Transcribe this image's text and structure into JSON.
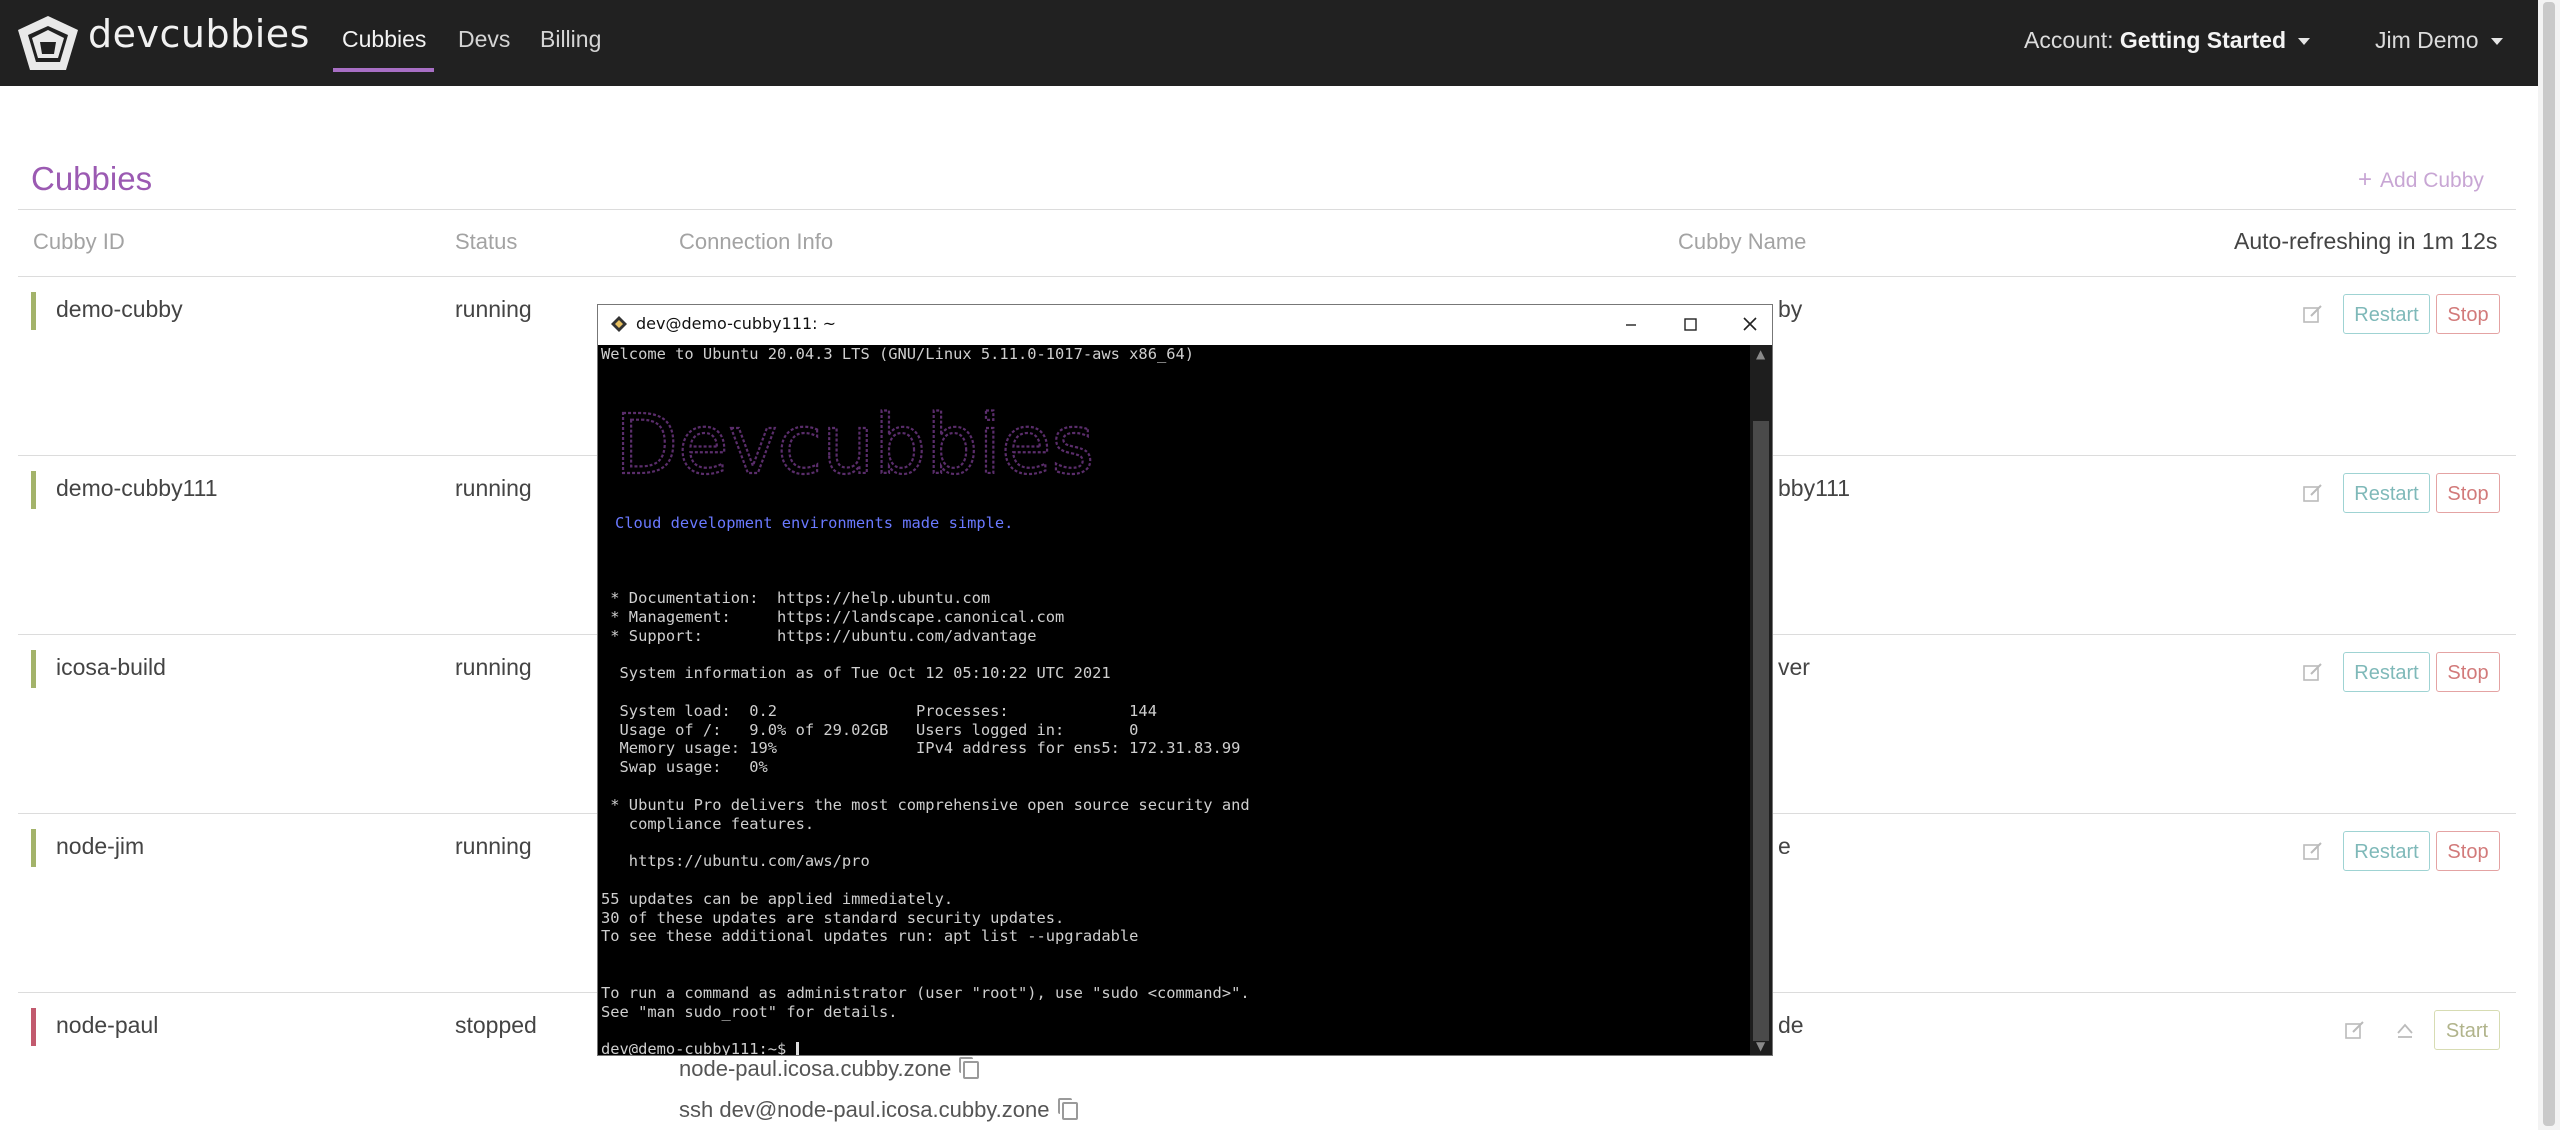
{
  "navbar": {
    "brand": "devcubbies",
    "links": [
      "Cubbies",
      "Devs",
      "Billing"
    ],
    "account_label": "Account:",
    "account_name": "Getting Started",
    "user": "Jim Demo"
  },
  "page": {
    "title": "Cubbies",
    "add_label": "Add Cubby",
    "columns": [
      "Cubby ID",
      "Status",
      "Connection Info",
      "Cubby Name"
    ],
    "auto_refresh": "Auto-refreshing in 1m 12s"
  },
  "rows": [
    {
      "id": "demo-cubby",
      "status": "running",
      "name_visible": "by",
      "color": "#a3b36a"
    },
    {
      "id": "demo-cubby111",
      "status": "running",
      "name_visible": "bby111",
      "color": "#a3b36a"
    },
    {
      "id": "icosa-build",
      "status": "running",
      "name_visible": "ver",
      "color": "#a3b36a"
    },
    {
      "id": "node-jim",
      "status": "running",
      "name_visible": "e",
      "color": "#a3b36a"
    },
    {
      "id": "node-paul",
      "status": "stopped",
      "name_visible": "de",
      "color": "#c25a6e",
      "conn": [
        "node-paul.icosa.cubby.zone",
        "ssh dev@node-paul.icosa.cubby.zone"
      ]
    }
  ],
  "buttons": {
    "restart": "Restart",
    "stop": "Stop",
    "start": "Start"
  },
  "terminal": {
    "title": "dev@demo-cubby111: ~",
    "welcome": "Welcome to Ubuntu 20.04.3 LTS (GNU/Linux 5.11.0-1017-aws x86_64)",
    "ascii_art": "Devcubbies",
    "tagline": "Cloud development environments made simple.",
    "docs": [
      " * Documentation:  https://help.ubuntu.com",
      " * Management:     https://landscape.canonical.com",
      " * Support:        https://ubuntu.com/advantage"
    ],
    "sysinfo_header": "  System information as of Tue Oct 12 05:10:22 UTC 2021",
    "sysinfo": [
      "  System load:  0.2               Processes:             144",
      "  Usage of /:   9.0% of 29.02GB   Users logged in:       0",
      "  Memory usage: 19%               IPv4 address for ens5: 172.31.83.99",
      "  Swap usage:   0%"
    ],
    "pro": [
      " * Ubuntu Pro delivers the most comprehensive open source security and",
      "   compliance features.",
      "",
      "   https://ubuntu.com/aws/pro"
    ],
    "updates": [
      "55 updates can be applied immediately.",
      "30 of these updates are standard security updates.",
      "To see these additional updates run: apt list --upgradable"
    ],
    "sudo": [
      "To run a command as administrator (user \"root\"), use \"sudo <command>\".",
      "See \"man sudo_root\" for details."
    ],
    "prompt": "dev@demo-cubby111:~$ "
  }
}
